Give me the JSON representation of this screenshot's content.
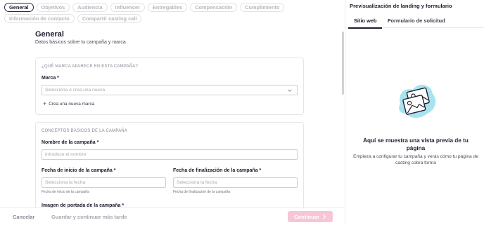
{
  "tabs": [
    {
      "label": "General",
      "active": true
    },
    {
      "label": "Objetivos"
    },
    {
      "label": "Audiencia"
    },
    {
      "label": "Influencer"
    },
    {
      "label": "Entregables"
    },
    {
      "label": "Compensación"
    },
    {
      "label": "Cumplimiento"
    },
    {
      "label": "Información de contacto"
    },
    {
      "label": "Compartir casting call"
    }
  ],
  "form": {
    "title": "General",
    "subtitle": "Datos básicos sobre tu campaña y marca",
    "brand_section": {
      "heading": "¿QUÉ MARCA APARECE EN ESTA CAMPAÑA?",
      "brand_label": "Marca *",
      "brand_placeholder": "Selecciona o crea una nueva",
      "create_link": "Crea una nueva marca"
    },
    "basics_section": {
      "heading": "CONCEPTOS BÁSICOS DE LA CAMPAÑA",
      "name_label": "Nombre de la campaña *",
      "name_placeholder": "Introduce el nombre",
      "start_label": "Fecha de inicio de la campaña *",
      "start_placeholder": "Selecciona la fecha",
      "start_hint": "Fecha de inicio de la campaña",
      "end_label": "Fecha de finalización de la campaña *",
      "end_placeholder": "Selecciona la fecha",
      "end_hint": "Fecha de finalización de la campaña",
      "cover_label": "Imagen de portada de la campaña *"
    }
  },
  "footer": {
    "cancel": "Cancelar",
    "save": "Guardar y continuar más tarde",
    "continue": "Continuar"
  },
  "preview": {
    "title": "Previsualización de landing y formulario",
    "tabs": [
      "Sitio web",
      "Formulario de solicitud"
    ],
    "empty_title": "Aquí se muestra una vista previa de tu página",
    "empty_desc": "Empieza a configurar tu campaña y verás cómo tu página de casting cobra forma"
  },
  "colors": {
    "accent_disabled": "#f7c6d6",
    "illustration": "#a9e3f0"
  }
}
